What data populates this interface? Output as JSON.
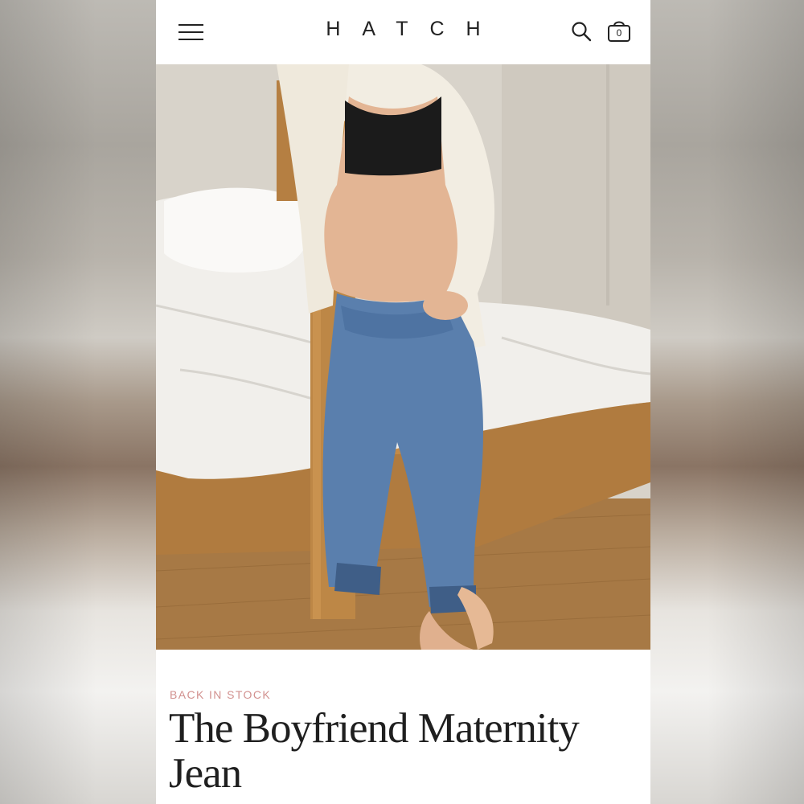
{
  "header": {
    "brand": "HATCH",
    "cart_count": "0",
    "icons": [
      "menu-icon",
      "search-icon",
      "shopping-bag-icon"
    ]
  },
  "hero": {
    "image": "photo-pregnant-woman-in-boyfriend-jeans-and-cream-cardigan"
  },
  "product": {
    "badge": "BACK IN STOCK",
    "title": "The Boyfriend Maternity Jean"
  },
  "colors": {
    "badge": "#d2918f",
    "text": "#1f1f1f",
    "background": "#ffffff"
  }
}
